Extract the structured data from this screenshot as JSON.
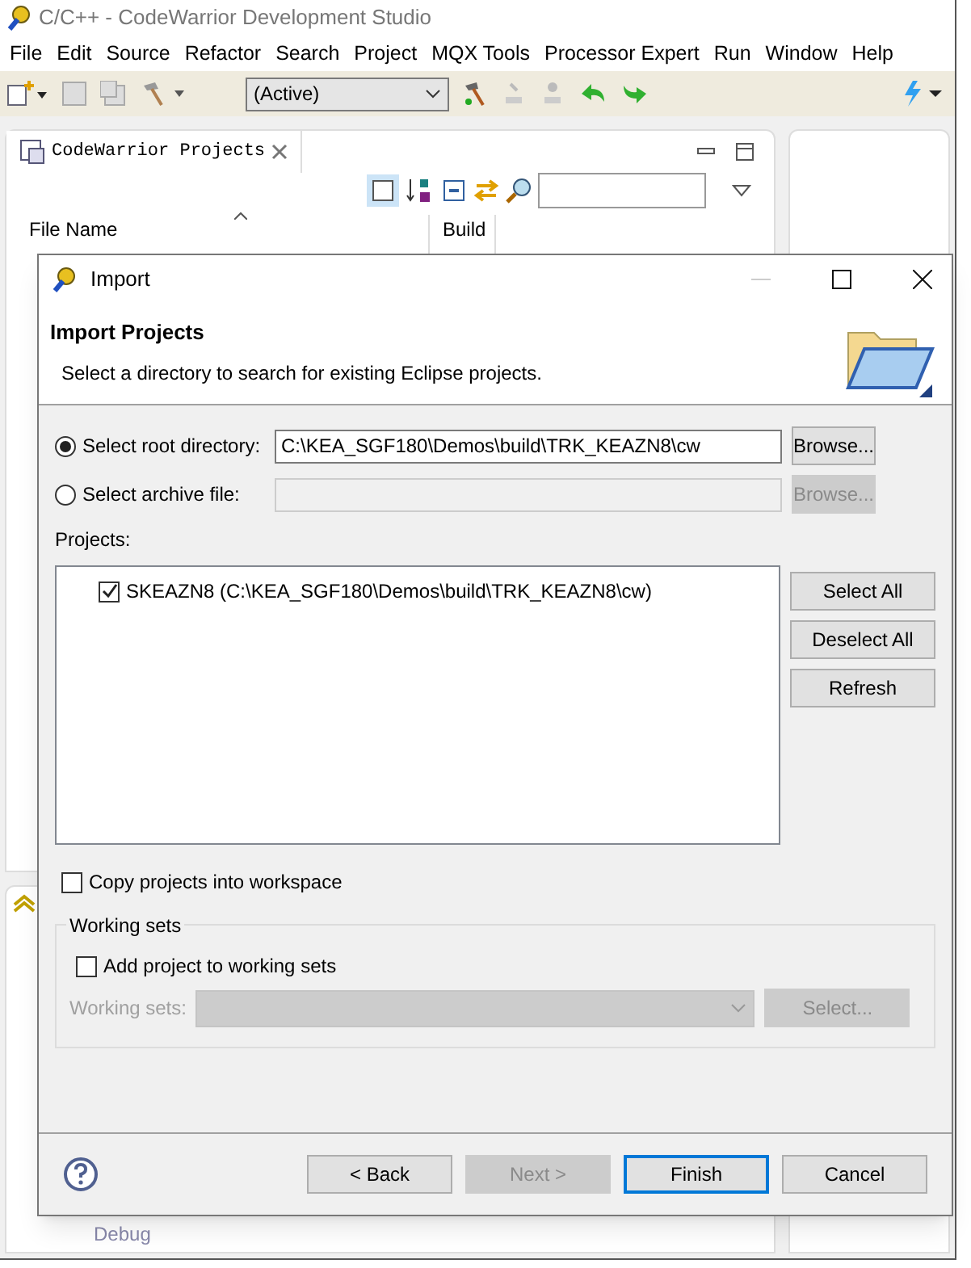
{
  "window": {
    "title": "C/C++ - CodeWarrior Development Studio"
  },
  "menu": [
    "File",
    "Edit",
    "Source",
    "Refactor",
    "Search",
    "Project",
    "MQX Tools",
    "Processor Expert",
    "Run",
    "Window",
    "Help"
  ],
  "toolbar": {
    "config": "(Active)"
  },
  "projects_view": {
    "tab": "CodeWarrior Projects",
    "columns": [
      "File Name",
      "Build"
    ]
  },
  "background_panel": {
    "label": "Debug"
  },
  "dialog": {
    "title": "Import",
    "heading": "Import Projects",
    "description": "Select a directory to search for existing Eclipse projects.",
    "source_options": [
      {
        "label": "Select root directory:",
        "selected": true,
        "value": "C:\\KEA_SGF180\\Demos\\build\\TRK_KEAZN8\\cw",
        "disabled": false,
        "button": "Browse..."
      },
      {
        "label": "Select archive file:",
        "selected": false,
        "disabled": true,
        "button": "Browse..."
      }
    ],
    "projects_label": "Projects:",
    "projects": [
      {
        "label": "SKEAZN8 (C:\\KEA_SGF180\\Demos\\build\\TRK_KEAZN8\\cw)",
        "checked": true
      }
    ],
    "project_buttons": [
      "Select All",
      "Deselect All",
      "Refresh"
    ],
    "copy_into_workspace": {
      "label": "Copy projects into workspace",
      "checked": false
    },
    "working_sets": {
      "title": "Working sets",
      "add": {
        "label": "Add project to working sets",
        "checked": false
      },
      "field_label": "Working sets:",
      "button": "Select...",
      "disabled": true
    },
    "buttons": [
      {
        "label": "< Back",
        "disabled": false,
        "default": false
      },
      {
        "label": "Next >",
        "disabled": true,
        "default": false
      },
      {
        "label": "Finish",
        "disabled": false,
        "default": true
      },
      {
        "label": "Cancel",
        "disabled": false,
        "default": false
      }
    ]
  }
}
